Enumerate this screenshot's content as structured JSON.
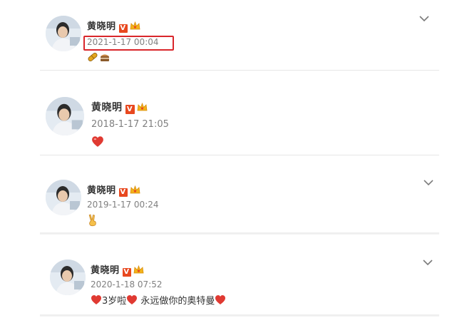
{
  "posts": [
    {
      "author": "黄晓明",
      "timestamp": "2021-1-17 00:04",
      "content": []
    },
    {
      "author": "黄晓明",
      "timestamp": "2018-1-17 21:05",
      "content": []
    },
    {
      "author": "黄晓明",
      "timestamp": "2019-1-17 00:24",
      "content": []
    },
    {
      "author": "黄晓明",
      "timestamp": "2020-1-18 07:52",
      "text_a": "3岁啦",
      "text_b": " 永远做你的奥特曼"
    }
  ],
  "badges": {
    "verified": "V"
  },
  "colors": {
    "highlight_box": "#d9262b",
    "heart": "#e03a32",
    "verified_badge": "#e8481f"
  },
  "icons": [
    "chevron-down-icon",
    "verified-badge-icon",
    "crown-badge-icon",
    "heart-emoji",
    "pill-emoji",
    "cake-emoji",
    "victory-hand-emoji"
  ]
}
